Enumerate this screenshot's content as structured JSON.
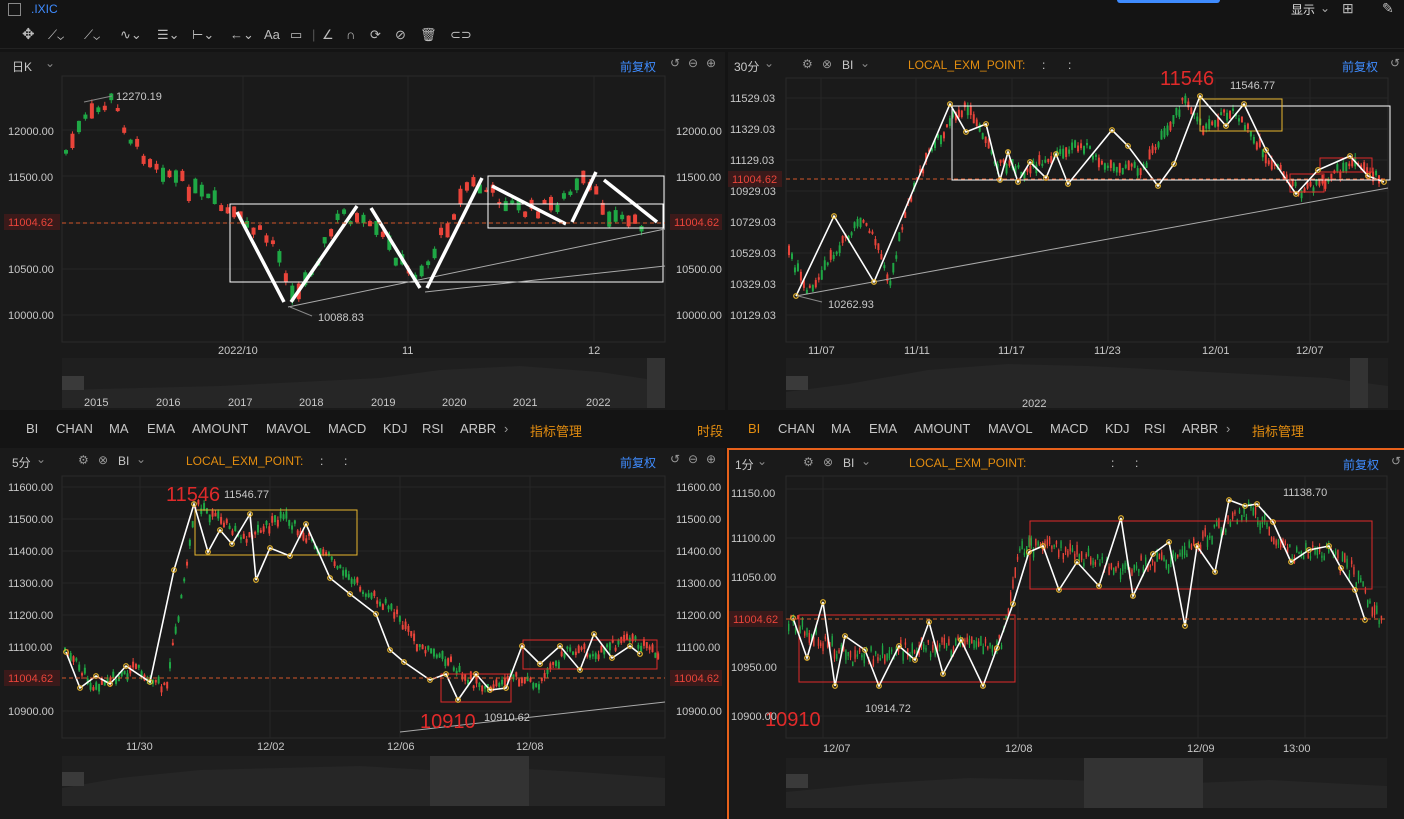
{
  "window": {
    "symbol": ".IXIC",
    "display_menu": "显示"
  },
  "toolbar": {
    "text_tool": "Aa"
  },
  "panels": {
    "p1": {
      "period": "日K",
      "adjust": "前复权",
      "price_tag": "11004.62",
      "y_ticks": [
        "12000.00",
        "11500.00",
        "11004.62",
        "10500.00",
        "10000.00"
      ],
      "x_ticks": [
        "2022/10",
        "11",
        "12"
      ],
      "annotations": {
        "high": "12270.19",
        "low": "10088.83"
      },
      "nav_years": [
        "2015",
        "2016",
        "2017",
        "2018",
        "2019",
        "2020",
        "2021",
        "2022"
      ]
    },
    "p2": {
      "period": "30分",
      "indicator": "BI",
      "formula": "LOCAL_EXM_POINT:",
      "sep1": ":",
      "sep2": ":",
      "adjust": "前复权",
      "price_tag": "11004.62",
      "y_ticks": [
        "11529.03",
        "11329.03",
        "11129.03",
        "10929.03",
        "10729.03",
        "10529.03",
        "10329.03",
        "10129.03"
      ],
      "x_ticks": [
        "11/07",
        "11/11",
        "11/17",
        "11/23",
        "12/01",
        "12/07"
      ],
      "annotations": {
        "big_high": "11546",
        "high": "11546.77",
        "low": "10262.93"
      },
      "nav_year": "2022"
    },
    "p3": {
      "period": "5分",
      "indicator": "BI",
      "formula": "LOCAL_EXM_POINT:",
      "sep1": ":",
      "sep2": ":",
      "adjust": "前复权",
      "price_tag": "11004.62",
      "y_ticks": [
        "11600.00",
        "11500.00",
        "11400.00",
        "11300.00",
        "11200.00",
        "11100.00",
        "11004.62",
        "10900.00"
      ],
      "x_ticks": [
        "11/30",
        "12/02",
        "12/06",
        "12/08"
      ],
      "annotations": {
        "big_high": "11546",
        "high": "11546.77",
        "big_low": "10910",
        "low": "10910.62"
      }
    },
    "p4": {
      "period": "1分",
      "indicator": "BI",
      "formula": "LOCAL_EXM_POINT:",
      "sep1": ":",
      "sep2": ":",
      "adjust": "前复权",
      "price_tag": "11004.62",
      "y_ticks": [
        "11150.00",
        "11100.00",
        "11050.00",
        "11004.62",
        "10950.00",
        "10900.00"
      ],
      "x_ticks": [
        "12/07",
        "12/08",
        "12/09",
        "13:00"
      ],
      "annotations": {
        "high": "11138.70",
        "big_low": "10910",
        "low": "10914.72"
      }
    }
  },
  "indicator_bar_left": [
    "BI",
    "CHAN",
    "MA",
    "EMA",
    "AMOUNT",
    "MAVOL",
    "MACD",
    "KDJ",
    "RSI",
    "ARBR",
    "指标管理",
    "时段"
  ],
  "indicator_bar_right": [
    "BI",
    "CHAN",
    "MA",
    "EMA",
    "AMOUNT",
    "MAVOL",
    "MACD",
    "KDJ",
    "RSI",
    "ARBR",
    "指标管理"
  ],
  "colors": {
    "up": "#1fa845",
    "down": "#e9443a",
    "accent": "#3f8cff",
    "formula": "#e38d10",
    "price_line": "#d2562b",
    "box_yellow": "#e8b62e",
    "box_red": "#e02a2a",
    "active_border": "#e8611b"
  }
}
